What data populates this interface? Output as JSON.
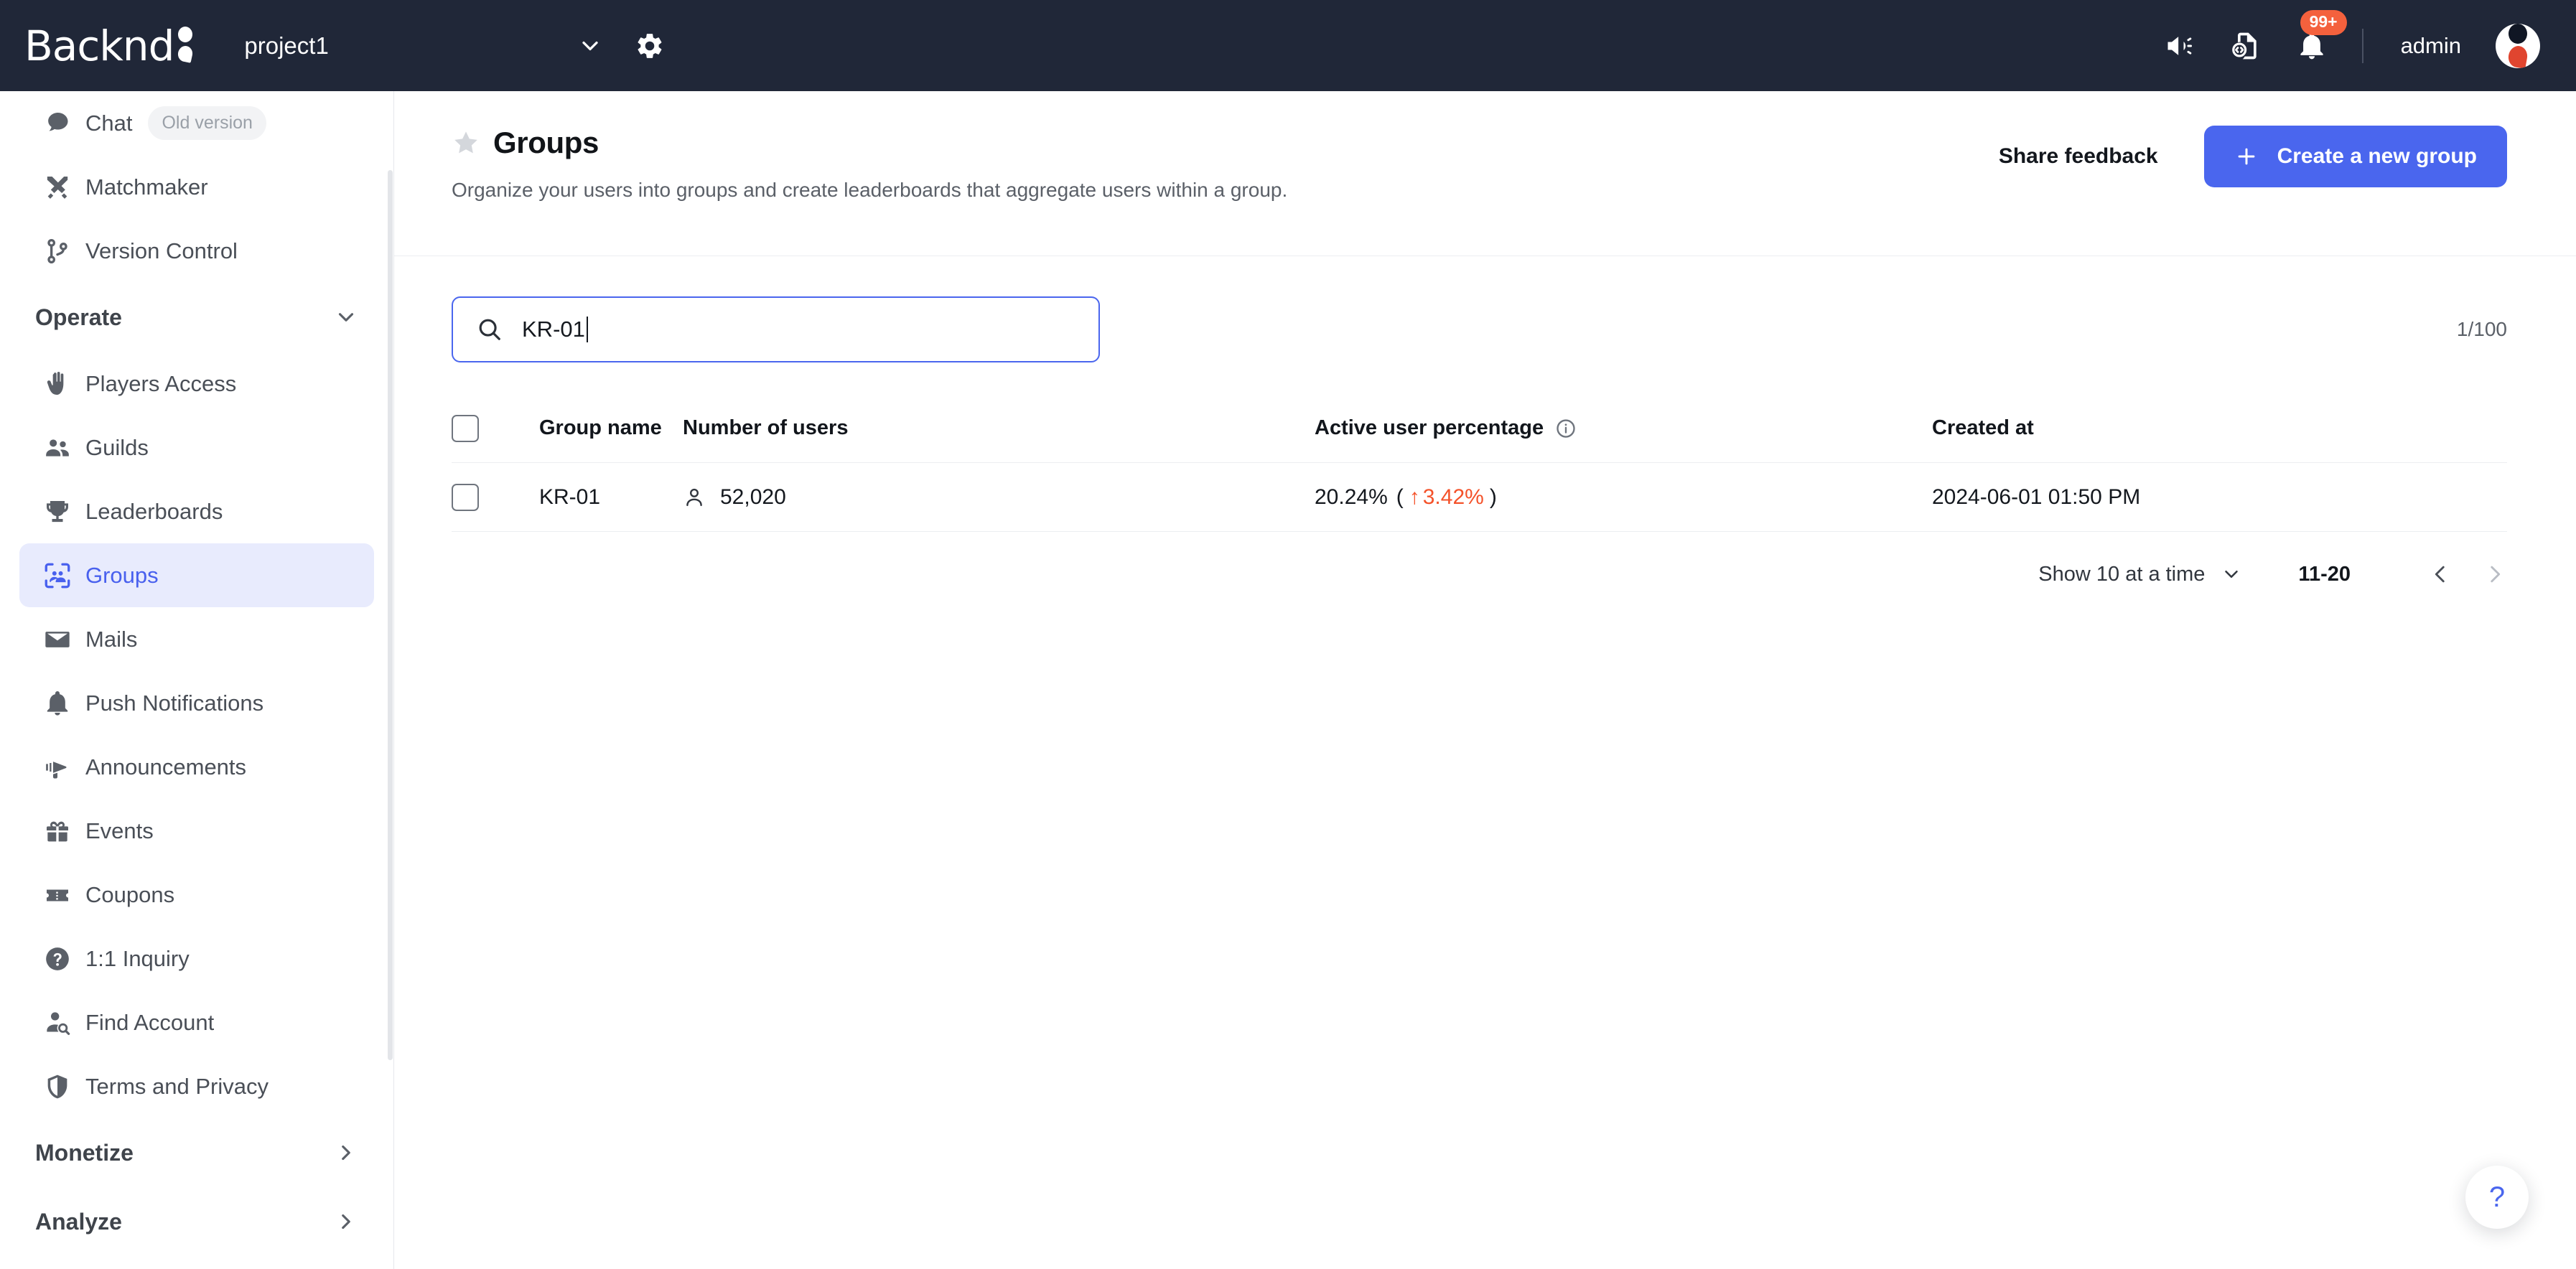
{
  "topbar": {
    "logo_text": "Backnd",
    "project_name": "project1",
    "project_chevron_icon": "chevron-down-icon",
    "settings_icon": "gear-icon",
    "megaphone_icon": "megaphone-icon",
    "docs_icon": "code-document-icon",
    "bell_icon": "bell-icon",
    "notification_badge": "99+",
    "admin_label": "admin",
    "avatar_icon": "user-avatar"
  },
  "sidebar": {
    "items": [
      {
        "label": "Chat",
        "icon": "chat-bubble-icon",
        "badge": "Old version",
        "active": false
      },
      {
        "label": "Matchmaker",
        "icon": "crossed-swords-icon",
        "badge": null,
        "active": false
      },
      {
        "label": "Version Control",
        "icon": "git-branch-icon",
        "badge": null,
        "active": false
      }
    ],
    "sections": [
      {
        "label": "Operate",
        "chevron": "chevron-down-icon",
        "expanded": true,
        "items": [
          {
            "label": "Players Access",
            "icon": "hand-icon",
            "active": false
          },
          {
            "label": "Guilds",
            "icon": "people-icon",
            "active": false
          },
          {
            "label": "Leaderboards",
            "icon": "trophy-icon",
            "active": false
          },
          {
            "label": "Groups",
            "icon": "groups-scan-icon",
            "active": true
          },
          {
            "label": "Mails",
            "icon": "envelope-icon",
            "active": false
          },
          {
            "label": "Push Notifications",
            "icon": "bell-icon",
            "active": false
          },
          {
            "label": "Announcements",
            "icon": "megaphone-icon",
            "active": false
          },
          {
            "label": "Events",
            "icon": "gift-icon",
            "active": false
          },
          {
            "label": "Coupons",
            "icon": "ticket-icon",
            "active": false
          },
          {
            "label": "1:1 Inquiry",
            "icon": "question-circle-icon",
            "active": false
          },
          {
            "label": "Find Account",
            "icon": "person-search-icon",
            "active": false
          },
          {
            "label": "Terms and Privacy",
            "icon": "shield-icon",
            "active": false
          }
        ]
      },
      {
        "label": "Monetize",
        "chevron": "chevron-right-icon",
        "expanded": false,
        "items": []
      },
      {
        "label": "Analyze",
        "chevron": "chevron-right-icon",
        "expanded": false,
        "items": []
      }
    ]
  },
  "page": {
    "favorite_icon": "star-icon",
    "title": "Groups",
    "subtitle": "Organize your users into groups and create leaderboards that aggregate users within a group.",
    "share_feedback_label": "Share feedback",
    "create_button_label": "Create a new group",
    "create_button_icon": "plus-icon",
    "create_button_color": "#4a66ee"
  },
  "search": {
    "icon": "search-icon",
    "value": "KR-01",
    "placeholder": "",
    "focused": true,
    "result_count": "1/100"
  },
  "table": {
    "columns": [
      {
        "key": "checkbox",
        "label": ""
      },
      {
        "key": "group_name",
        "label": "Group name"
      },
      {
        "key": "number_of_users",
        "label": "Number of users"
      },
      {
        "key": "active_user_percentage",
        "label": "Active user percentage",
        "info_icon": "info-icon"
      },
      {
        "key": "created_at",
        "label": "Created at"
      }
    ],
    "rows": [
      {
        "selected": false,
        "group_name": "KR-01",
        "users_icon": "person-icon",
        "number_of_users": "52,020",
        "active_percentage": "20.24%",
        "delta_open": "(",
        "delta_arrow": "↑",
        "delta_value": "3.42%",
        "delta_close": ")",
        "delta_color": "#f4522a",
        "created_at": "2024-06-01 01:50  PM"
      }
    ]
  },
  "pagination": {
    "page_size_label": "Show 10 at a time",
    "page_size_chevron": "chevron-down-icon",
    "range_label": "11-20",
    "prev_icon": "chevron-left-icon",
    "next_icon": "chevron-right-icon"
  },
  "help": {
    "icon": "question-mark-icon",
    "label": "?"
  }
}
